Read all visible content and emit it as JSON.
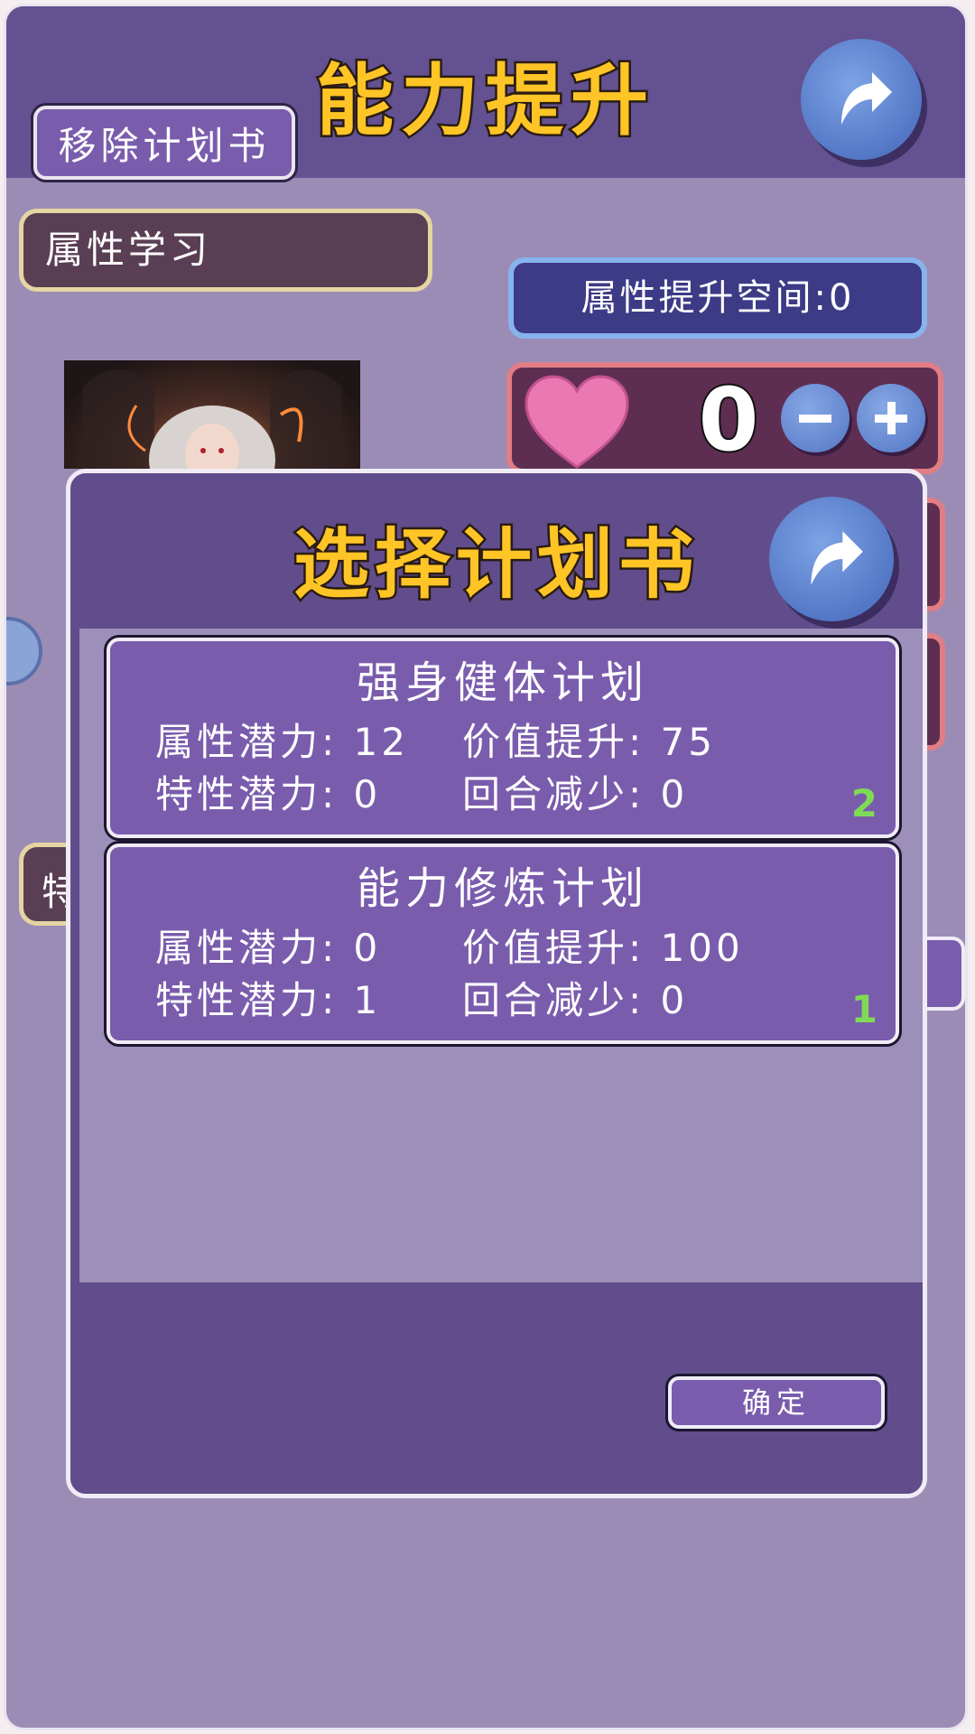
{
  "header": {
    "title": "能力提升",
    "remove_button_label": "移除计划书"
  },
  "attribute_section": {
    "title": "属性学习",
    "space_label": "属性提升空间:0",
    "heart_value": "0"
  },
  "partial_label": "特",
  "dialog": {
    "title": "选择计划书",
    "confirm_label": "确定",
    "plans": [
      {
        "name": "强身健体计划",
        "row1_left": "属性潜力:  12",
        "row1_right": "价值提升:  75",
        "row2_left": "特性潜力:  0",
        "row2_right": "回合减少:  0",
        "count": "2"
      },
      {
        "name": "能力修炼计划",
        "row1_left": "属性潜力:  0",
        "row1_right": "价值提升:  100",
        "row2_left": "特性潜力:  1",
        "row2_right": "回合减少:  0",
        "count": "1"
      }
    ]
  },
  "icons": {
    "back": "back-arrow-icon",
    "heart": "heart-icon",
    "minus": "minus-icon",
    "plus": "plus-icon"
  },
  "colors": {
    "title_gold": "#ffc526",
    "panel_purple": "#614d8b",
    "card_purple": "#7a5cad",
    "count_green": "#7fda55",
    "heart_pink": "#ea79b3"
  }
}
